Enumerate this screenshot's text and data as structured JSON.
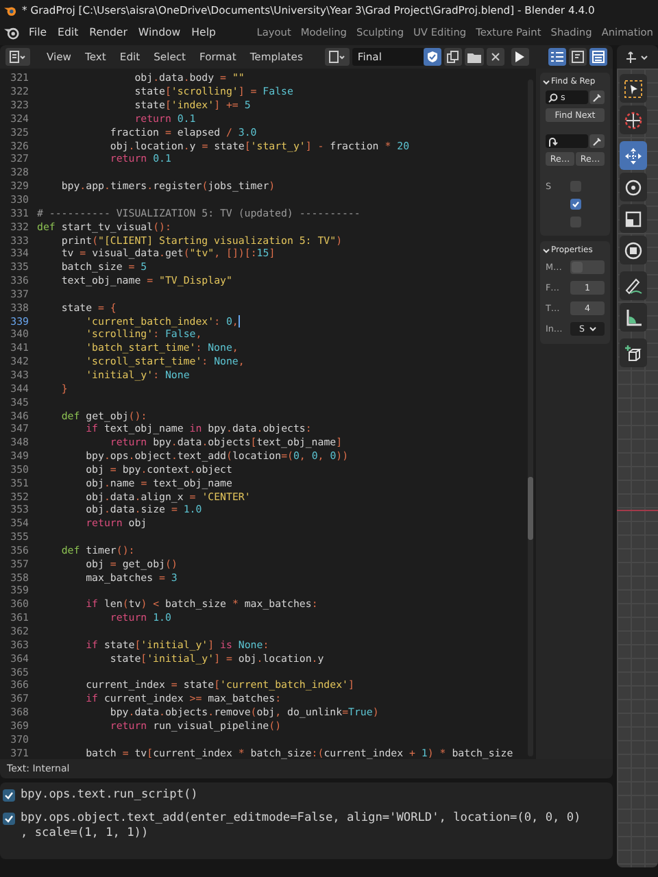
{
  "title_bar": {
    "title": "* GradProj [C:\\Users\\aisra\\OneDrive\\Documents\\University\\Year 3\\Grad Project\\GradProj.blend] - Blender 4.4.0"
  },
  "menu": [
    "File",
    "Edit",
    "Render",
    "Window",
    "Help"
  ],
  "workspaces": [
    {
      "label": "Layout",
      "selected": false
    },
    {
      "label": "Modeling",
      "selected": false
    },
    {
      "label": "Sculpting",
      "selected": false
    },
    {
      "label": "UV Editing",
      "selected": false
    },
    {
      "label": "Texture Paint",
      "selected": false
    },
    {
      "label": "Shading",
      "selected": false
    },
    {
      "label": "Animation",
      "selected": false
    }
  ],
  "text_editor": {
    "menus": [
      "View",
      "Text",
      "Edit",
      "Select",
      "Format",
      "Templates"
    ],
    "file_name": "Final",
    "fake_user": true,
    "line_numbers": true,
    "word_wrap": false,
    "syntax_highlight": true,
    "lines": [
      {
        "number": "321",
        "text": "                obj.data.body = \"\"",
        "selected": false
      },
      {
        "number": "322",
        "text": "                state['scrolling'] = False",
        "selected": false
      },
      {
        "number": "323",
        "text": "                state['index'] += 5",
        "selected": false
      },
      {
        "number": "324",
        "text": "                return 0.1",
        "selected": false
      },
      {
        "number": "325",
        "text": "            fraction = elapsed / 3.0",
        "selected": false
      },
      {
        "number": "326",
        "text": "            obj.location.y = state['start_y'] - fraction * 20",
        "selected": false
      },
      {
        "number": "327",
        "text": "            return 0.1",
        "selected": false
      },
      {
        "number": "328",
        "selected": false
      },
      {
        "number": "329",
        "text": "    bpy.app.timers.register(jobs_timer)",
        "selected": false
      },
      {
        "number": "330",
        "selected": false
      },
      {
        "number": "331",
        "text": "# ---------- VISUALIZATION 5: TV (updated) ----------",
        "selected": false
      },
      {
        "number": "332",
        "text": "def start_tv_visual():",
        "selected": false
      },
      {
        "number": "333",
        "text": "    print(\"[CLIENT] Starting visualization 5: TV\")",
        "selected": false
      },
      {
        "number": "334",
        "text": "    tv = visual_data.get(\"tv\", [])[:15]",
        "selected": false
      },
      {
        "number": "335",
        "text": "    batch_size = 5",
        "selected": false
      },
      {
        "number": "336",
        "text": "    text_obj_name = \"TV_Display\"",
        "selected": false
      },
      {
        "number": "337",
        "selected": false
      },
      {
        "number": "338",
        "text": "    state = {",
        "selected": false
      },
      {
        "number": "339",
        "text": "        'current_batch_index': 0,",
        "selected": true
      },
      {
        "number": "340",
        "text": "        'scrolling': False,",
        "selected": false
      },
      {
        "number": "341",
        "text": "        'batch_start_time': None,",
        "selected": false
      },
      {
        "number": "342",
        "text": "        'scroll_start_time': None,",
        "selected": false
      },
      {
        "number": "343",
        "text": "        'initial_y': None",
        "selected": false
      },
      {
        "number": "344",
        "text": "    }",
        "selected": false
      },
      {
        "number": "345",
        "selected": false
      },
      {
        "number": "346",
        "text": "    def get_obj():",
        "selected": false
      },
      {
        "number": "347",
        "text": "        if text_obj_name in bpy.data.objects:",
        "selected": false
      },
      {
        "number": "348",
        "text": "            return bpy.data.objects[text_obj_name]",
        "selected": false
      },
      {
        "number": "349",
        "text": "        bpy.ops.object.text_add(location=(0, 0, 0))",
        "selected": false
      },
      {
        "number": "350",
        "text": "        obj = bpy.context.object",
        "selected": false
      },
      {
        "number": "351",
        "text": "        obj.name = text_obj_name",
        "selected": false
      },
      {
        "number": "352",
        "text": "        obj.data.align_x = 'CENTER'",
        "selected": false
      },
      {
        "number": "353",
        "text": "        obj.data.size = 1.0",
        "selected": false
      },
      {
        "number": "354",
        "text": "        return obj",
        "selected": false
      },
      {
        "number": "355",
        "selected": false
      },
      {
        "number": "356",
        "text": "    def timer():",
        "selected": false
      },
      {
        "number": "357",
        "text": "        obj = get_obj()",
        "selected": false
      },
      {
        "number": "358",
        "text": "        max_batches = 3",
        "selected": false
      },
      {
        "number": "359",
        "selected": false
      },
      {
        "number": "360",
        "text": "        if len(tv) < batch_size * max_batches:",
        "selected": false
      },
      {
        "number": "361",
        "text": "            return 1.0",
        "selected": false
      },
      {
        "number": "362",
        "selected": false
      },
      {
        "number": "363",
        "text": "        if state['initial_y'] is None:",
        "selected": false
      },
      {
        "number": "364",
        "text": "            state['initial_y'] = obj.location.y",
        "selected": false
      },
      {
        "number": "365",
        "selected": false
      },
      {
        "number": "366",
        "text": "        current_index = state['current_batch_index']",
        "selected": false
      },
      {
        "number": "367",
        "text": "        if current_index >= max_batches:",
        "selected": false
      },
      {
        "number": "368",
        "text": "            bpy.data.objects.remove(obj, do_unlink=True)",
        "selected": false
      },
      {
        "number": "369",
        "text": "            return run_visual_pipeline()",
        "selected": false
      },
      {
        "number": "370",
        "selected": false
      },
      {
        "number": "371",
        "text": "        batch = tv[current_index * batch_size:(current_index + 1) * batch_size",
        "selected": false
      }
    ],
    "footer": "Text: Internal"
  },
  "find_replace": {
    "title": "Find & Rep",
    "find_value": "s",
    "find_next": "Find Next",
    "replace_buttons": [
      "Re…",
      "Re…"
    ],
    "options": [
      {
        "label": "S",
        "checked": false
      },
      {
        "checked": true
      },
      {
        "checked": false
      }
    ]
  },
  "properties": {
    "title": "Properties",
    "rows": [
      {
        "kind": "toggle",
        "label": "M…",
        "on": false
      },
      {
        "kind": "number",
        "label": "F…",
        "value": "1"
      },
      {
        "kind": "number",
        "label": "T…",
        "value": "4"
      },
      {
        "kind": "dropdown",
        "label": "In…",
        "value": "S"
      }
    ]
  },
  "tools": [
    {
      "kind": "select_box",
      "selected": false
    },
    {
      "kind": "cursor",
      "selected": false
    },
    {
      "kind": "move",
      "selected": true
    },
    {
      "kind": "rotate",
      "selected": false
    },
    {
      "kind": "scale",
      "selected": false
    },
    {
      "kind": "transform",
      "selected": false
    },
    {
      "kind": "annotate",
      "selected": false
    },
    {
      "kind": "measure",
      "selected": false
    },
    {
      "kind": "add_cube",
      "selected": false
    }
  ],
  "console": [
    {
      "lines": [
        "bpy.ops.text.run_script()"
      ]
    },
    {
      "lines": [
        "bpy.ops.object.text_add(enter_editmode=False, align='WORLD', location=(0, 0, 0)",
        ", scale=(1, 1, 1))"
      ]
    }
  ]
}
